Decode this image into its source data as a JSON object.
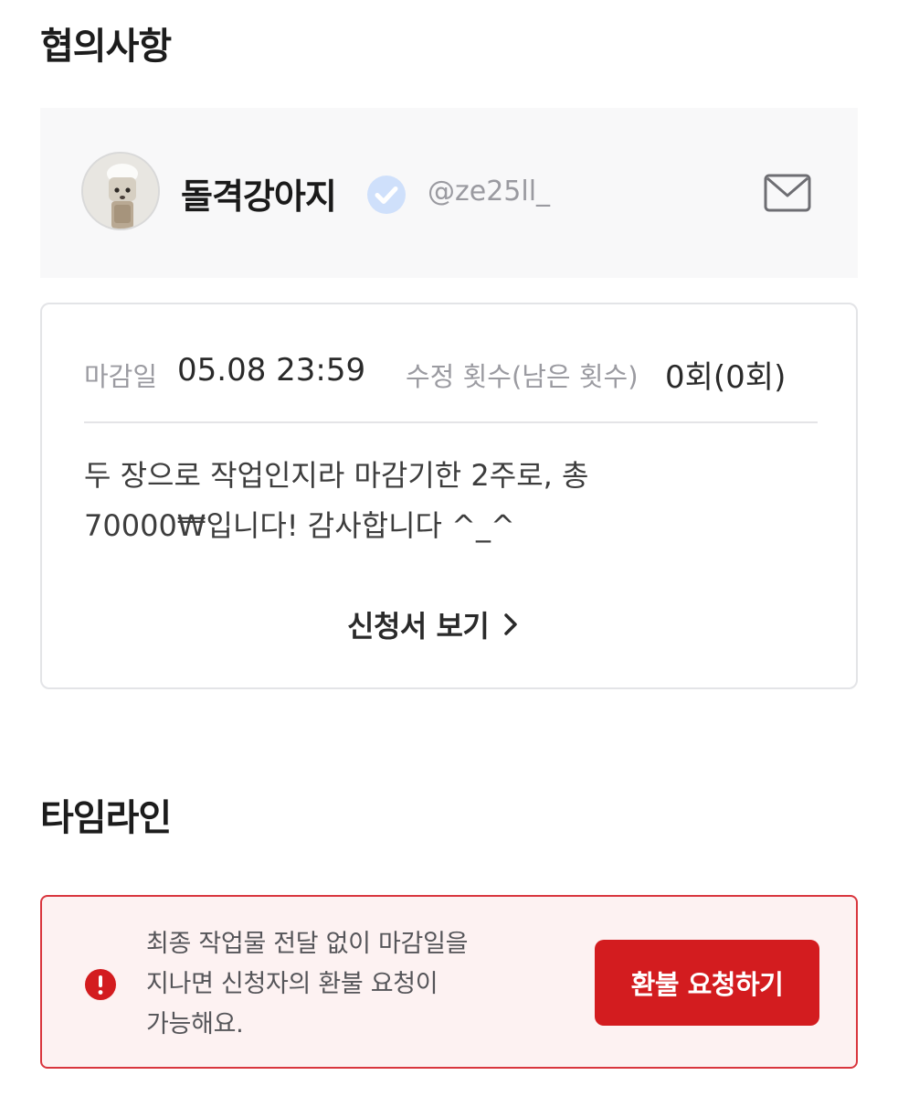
{
  "sections": {
    "agreement_title": "협의사항",
    "timeline_title": "타임라인"
  },
  "profile": {
    "name": "돌격강아지",
    "handle": "@ze25ll_",
    "verified": true,
    "verified_color": "#cfe0fb",
    "icons": [
      "avatar-image",
      "verified-badge-icon",
      "mail-icon"
    ]
  },
  "details": {
    "deadline_label": "마감일",
    "deadline_value": "05.08 23:59",
    "revision_label": "수정 횟수(남은 횟수)",
    "revision_value": "0회(0회)",
    "message_line1": "두 장으로 작업인지라 마감기한 2주로, 총",
    "message_line2": "70000₩입니다! 감사합니다 ^_^",
    "view_application_label": "신청서 보기"
  },
  "timeline": {
    "alert_line1": "최종 작업물 전달 없이 마감일을",
    "alert_line2": "지나면 신청자의 환불 요청이",
    "alert_line3": "가능해요.",
    "refund_button_label": "환불 요청하기",
    "alert_color": "#d31c1f",
    "alert_background": "#fdf2f2"
  }
}
